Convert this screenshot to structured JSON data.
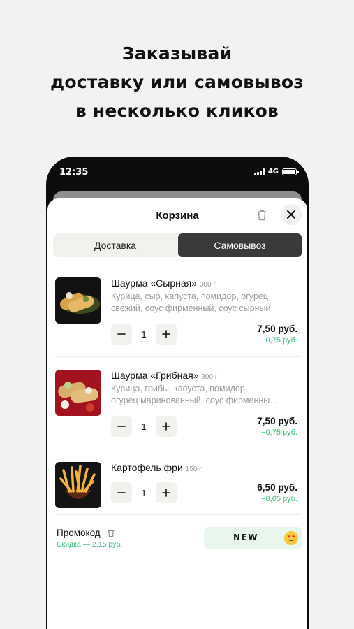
{
  "headline": {
    "line1": "Заказывай",
    "line2": "доставку или самовывоз",
    "line3": "в несколько кликов"
  },
  "status_bar": {
    "time": "12:35",
    "network": "4G"
  },
  "cart": {
    "title": "Корзина",
    "trash_icon": "trash-icon",
    "close_icon": "close-icon",
    "tabs": [
      {
        "label": "Доставка",
        "active": false
      },
      {
        "label": "Самовывоз",
        "active": true
      }
    ],
    "items": [
      {
        "name": "Шаурма «Сырная»",
        "weight": "300 г",
        "description": "Курица, сыр, капуста, помидор, огурец свежий, соус фирменный, соус сырный.",
        "quantity": "1",
        "price": "7,50 руб.",
        "discount": "−0,75 руб."
      },
      {
        "name": "Шаурма «Грибная»",
        "weight": "300 г",
        "description_line1": "Курица, грибы, капуста, помидор,",
        "description_line2": "огурец маринованный, соус фирменны…",
        "quantity": "1",
        "price": "7,50 руб.",
        "discount": "−0,75 руб."
      },
      {
        "name": "Картофель фри",
        "weight": "150 г",
        "quantity": "1",
        "price": "6,50 руб.",
        "discount": "−0,65 руб."
      }
    ],
    "promo": {
      "label": "Промокод",
      "discount_text": "Скидка — 2,15 руб.",
      "code": "NEW",
      "emoji_icon": "heart-eyes-emoji-icon"
    }
  },
  "colors": {
    "accent_green": "#2bbd6e",
    "dark_segment": "#3a3a3a",
    "phone_frame": "#0d0d0d"
  }
}
